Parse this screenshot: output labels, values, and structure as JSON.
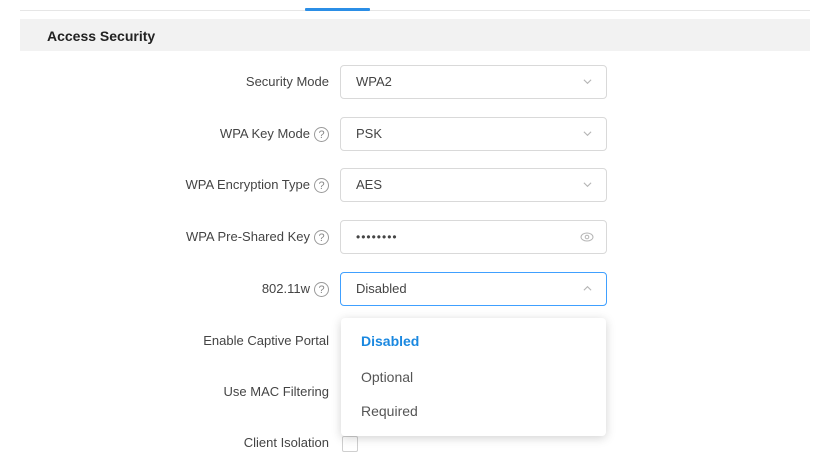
{
  "section": {
    "title": "Access Security"
  },
  "form": {
    "security_mode": {
      "label": "Security Mode",
      "value": "WPA2"
    },
    "wpa_key_mode": {
      "label": "WPA Key Mode",
      "value": "PSK"
    },
    "wpa_encryption_type": {
      "label": "WPA Encryption Type",
      "value": "AES"
    },
    "wpa_pre_shared_key": {
      "label": "WPA Pre-Shared Key",
      "value": "••••••••"
    },
    "ieee_80211w": {
      "label": "802.11w",
      "value": "Disabled",
      "open": true
    },
    "enable_captive_portal": {
      "label": "Enable Captive Portal"
    },
    "use_mac_filtering": {
      "label": "Use MAC Filtering"
    },
    "client_isolation": {
      "label": "Client Isolation",
      "checked": false
    }
  },
  "dropdown_80211w": {
    "options": [
      "Disabled",
      "Optional",
      "Required"
    ],
    "selected": "Disabled"
  },
  "icons": {
    "help": "question-circle-icon",
    "select": "chevron-down-icon",
    "select_open": "chevron-up-icon",
    "password": "eye-icon"
  },
  "colors": {
    "accent": "#2b8ee6",
    "selected_option": "#1a88e0",
    "focus_border": "#40a0ff",
    "section_bg": "#f2f2f2"
  }
}
